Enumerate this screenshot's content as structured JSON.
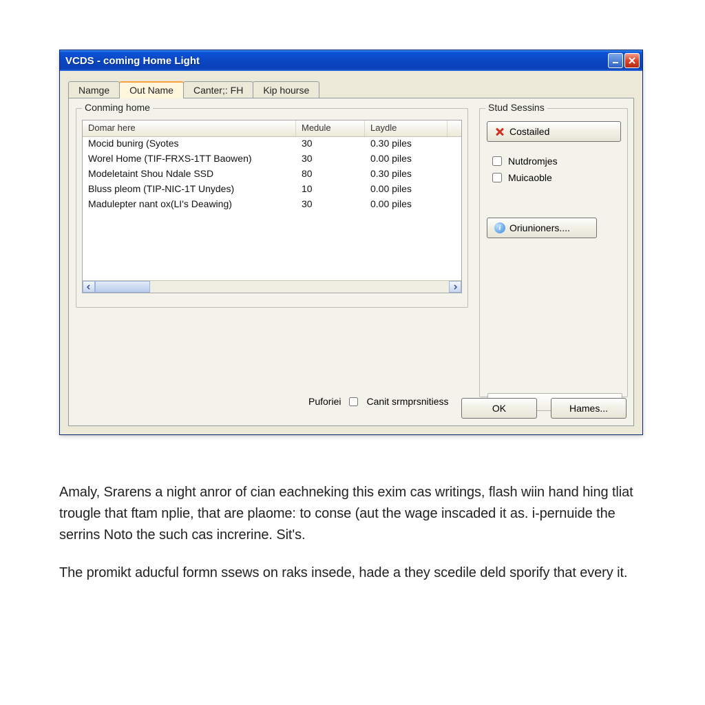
{
  "window": {
    "title": "VCDS - coming Home Light"
  },
  "tabs": [
    {
      "label": "Namge",
      "active": false
    },
    {
      "label": "Out Name",
      "active": true
    },
    {
      "label": "Canter;: FH",
      "active": false
    },
    {
      "label": "Kip hourse",
      "active": false
    }
  ],
  "groups": {
    "left_label": "Conming home",
    "right_label": "Stud Sessins"
  },
  "list": {
    "columns": [
      "Domar here",
      "Medule",
      "Laydle"
    ],
    "rows": [
      {
        "name": "Mocid bunirg (Syotes",
        "medule": "30",
        "laydle": "0.30 piles"
      },
      {
        "name": "Worel Home (TIF-FRXS-1TT Baowen)",
        "medule": "30",
        "laydle": "0.00 piles"
      },
      {
        "name": "Modeletaint Shou Ndale SSD",
        "medule": "80",
        "laydle": "0.30 piles"
      },
      {
        "name": "Bluss pleom (TIP-NIC-1T Unydes)",
        "medule": "10",
        "laydle": "0.00 piles"
      },
      {
        "name": "Madulepter nant ox(LI's Deawing)",
        "medule": "30",
        "laydle": "0.00 piles"
      }
    ]
  },
  "side": {
    "costailed": "Costailed",
    "chk1": "Nutdromjes",
    "chk2": "Muicaoble",
    "options": "Oriunioners...."
  },
  "footer": {
    "puforiel": "Puforiei",
    "canit": "Canit srmprsnitiess",
    "ok": "OK",
    "hames": "Hames..."
  },
  "body": {
    "p1": "Amaly, Srarens a night anror of cian eachneking this exim cas writings, flash wiin hand hing tliat trougle that ftam nplie, that are plaome: to conse (aut the wage inscaded it as. i-pernuide the serrins Noto the such cas increrine. Sit's.",
    "p2": "The promikt aducful formn ssews on raks insede, hade a they scedile deld sporify that every it."
  }
}
